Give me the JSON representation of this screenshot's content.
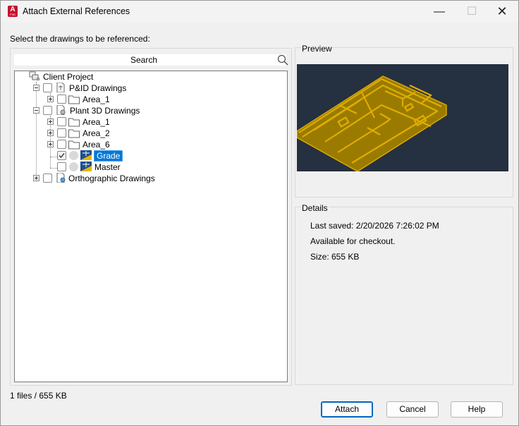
{
  "window": {
    "title": "Attach External References",
    "app_icon_letter": "A",
    "app_icon_sub": "P3D"
  },
  "prompt": "Select the drawings to be referenced:",
  "search": {
    "placeholder": "Search"
  },
  "tree": {
    "root": "Client Project",
    "pid": {
      "label": "P&ID Drawings",
      "children": [
        "Area_1"
      ]
    },
    "plant3d": {
      "label": "Plant 3D Drawings",
      "folders": [
        "Area_1",
        "Area_2",
        "Area_6"
      ],
      "drawings": [
        {
          "label": "Grade",
          "checked": true,
          "selected": true
        },
        {
          "label": "Master",
          "checked": false,
          "selected": false
        }
      ]
    },
    "ortho": {
      "label": "Orthographic Drawings"
    }
  },
  "preview": {
    "title": "Preview"
  },
  "details": {
    "title": "Details",
    "last_saved": "Last saved: 2/20/2026 7:26:02 PM",
    "availability": "Available for checkout.",
    "size": "Size: 655 KB"
  },
  "status": "1 files / 655 KB",
  "buttons": {
    "attach": "Attach",
    "cancel": "Cancel",
    "help": "Help"
  },
  "colors": {
    "selection": "#0078d7",
    "preview_bg": "#253040",
    "plan_fill": "#9a7b00",
    "plan_line": "#d6a400",
    "app_red": "#c8102e"
  }
}
